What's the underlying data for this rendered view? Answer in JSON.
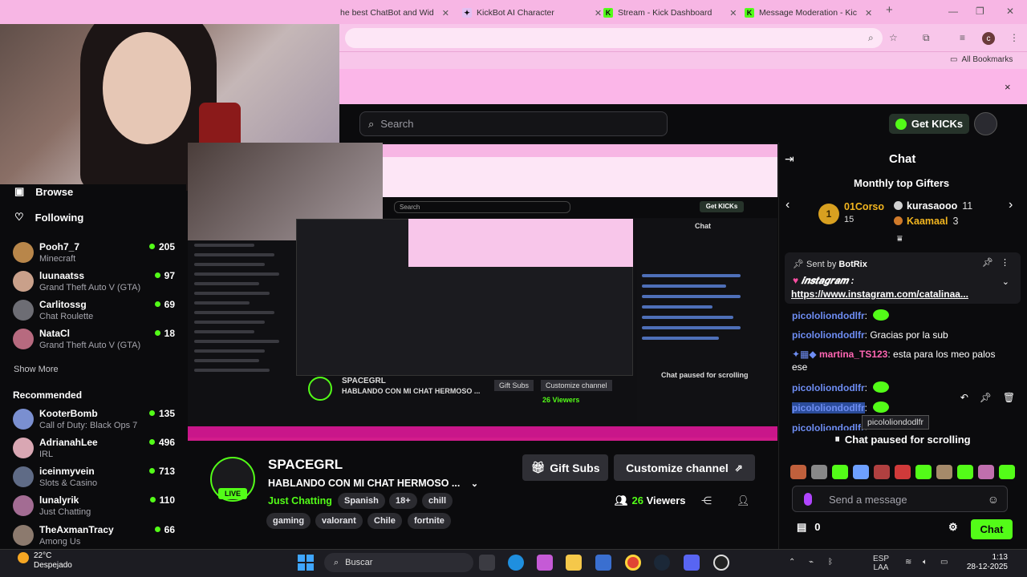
{
  "browser": {
    "tabs": [
      {
        "title": "he best ChatBot and Wid",
        "favicon": "chatbot"
      },
      {
        "title": "KickBot AI Character",
        "favicon": "kickbot"
      },
      {
        "title": "Stream - Kick Dashboard",
        "favicon": "kick-k"
      },
      {
        "title": "Message Moderation - Kic",
        "favicon": "kick-k"
      }
    ],
    "new_tab": "+",
    "profile_initial": "c",
    "bookmarks_label": "All Bookmarks",
    "banner_close": "×"
  },
  "kick": {
    "search_placeholder": "Search",
    "get_kicks": "Get KICKs"
  },
  "sidebar": {
    "browse": "Browse",
    "following": "Following",
    "followed": [
      {
        "name": "Pooh7_7",
        "category": "Minecraft",
        "viewers": "205",
        "color": "#b8864a"
      },
      {
        "name": "luunaatss",
        "category": "Grand Theft Auto V (GTA)",
        "viewers": "97",
        "color": "#c9a08a"
      },
      {
        "name": "Carlitossg",
        "category": "Chat Roulette",
        "viewers": "69",
        "color": "#6d6d74"
      },
      {
        "name": "NataCl",
        "category": "Grand Theft Auto V (GTA)",
        "viewers": "18",
        "color": "#b76a7f"
      }
    ],
    "show_more": "Show More",
    "recommended_label": "Recommended",
    "recommended": [
      {
        "name": "KooterBomb",
        "category": "Call of Duty: Black Ops 7",
        "viewers": "135",
        "color": "#7a8fd0"
      },
      {
        "name": "AdrianahLee",
        "category": "IRL",
        "viewers": "496",
        "color": "#d9a7b3"
      },
      {
        "name": "iceinmyvein",
        "category": "Slots & Casino",
        "viewers": "713",
        "color": "#5f6b86"
      },
      {
        "name": "lunalyrik",
        "category": "Just Chatting",
        "viewers": "110",
        "color": "#a36c93"
      },
      {
        "name": "TheAxmanTracy",
        "category": "Among Us",
        "viewers": "66",
        "color": "#8c7a6e"
      }
    ]
  },
  "nested": {
    "channel": "SPACEGRL",
    "title": "HABLANDO CON MI CHAT HERMOSO ...",
    "gift_subs": "Gift Subs",
    "customize": "Customize channel",
    "viewers": "26 Viewers",
    "chat": "Chat",
    "paused": "Chat paused for scrolling",
    "search": "Search",
    "get_kicks": "Get KICKs"
  },
  "channel": {
    "name": "SPACEGRL",
    "title": "HABLANDO CON MI CHAT HERMOSO ...",
    "category": "Just Chatting",
    "live": "LIVE",
    "tags_row1": [
      "Spanish",
      "18+",
      "chill"
    ],
    "tags_row2": [
      "gaming",
      "valorant",
      "Chile",
      "fortnite"
    ],
    "gift_subs": "Gift Subs",
    "customize": "Customize channel",
    "viewers_count": "26",
    "viewers_label": "Viewers"
  },
  "chat": {
    "title": "Chat",
    "gifters_title": "Monthly top Gifters",
    "top_gifter": {
      "rank": "1",
      "name": "01Corso",
      "count": "15"
    },
    "gifters": [
      {
        "name": "kurasaooo",
        "count": "11"
      },
      {
        "name": "Kaamaal",
        "count": "3"
      }
    ],
    "pinned": {
      "sent_by_label": "Sent by",
      "sender": "BotRix",
      "line1": "𝒊𝒏𝒔𝒕𝒂𝒈𝒓𝒂𝒎 :",
      "link": "https://www.instagram.com/catalinaa..."
    },
    "messages": [
      {
        "user": "picololiondodlfr",
        "text": ""
      },
      {
        "user": "picololiondodlfr",
        "text": "Gracias por la sub"
      },
      {
        "user": "martina_TS123",
        "text": "esta para los meo palos ese"
      },
      {
        "user": "picololiondodlfr",
        "text": ""
      },
      {
        "user": "picololiondodlfr",
        "text": ""
      },
      {
        "user": "picololiondodlfr",
        "text": ""
      }
    ],
    "tooltip": "picololiondodlfr",
    "paused": "Chat paused for scrolling",
    "placeholder": "Send a message",
    "points": "0",
    "send_button": "Chat"
  },
  "taskbar": {
    "temp": "22°C",
    "weather": "Despejado",
    "search": "Buscar",
    "lang1": "ESP",
    "lang2": "LAA",
    "time": "1:13",
    "date": "28-12-2025"
  },
  "colors": {
    "kick_green": "#53fc18",
    "accent_pink": "#f7b6e4",
    "username_blue": "#6e8df3",
    "gold": "#f2b51f"
  }
}
